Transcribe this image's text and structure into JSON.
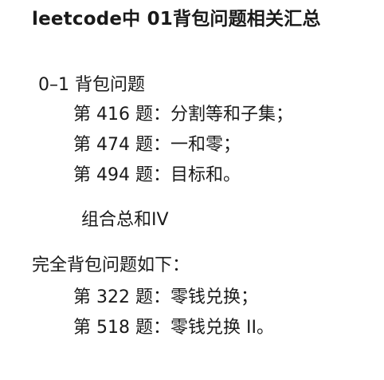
{
  "title": "leetcode中 01背包问题相关汇总",
  "section_01": {
    "heading": "0–1 背包问题",
    "items": [
      "第 416 题：分割等和子集；",
      "第 474 题：一和零；",
      "第 494 题：目标和。"
    ]
  },
  "extra_note": "组合总和IV",
  "section_complete": {
    "heading": "完全背包问题如下：",
    "items": [
      "第 322 题：零钱兑换；",
      "第 518 题：零钱兑换 II。"
    ]
  }
}
